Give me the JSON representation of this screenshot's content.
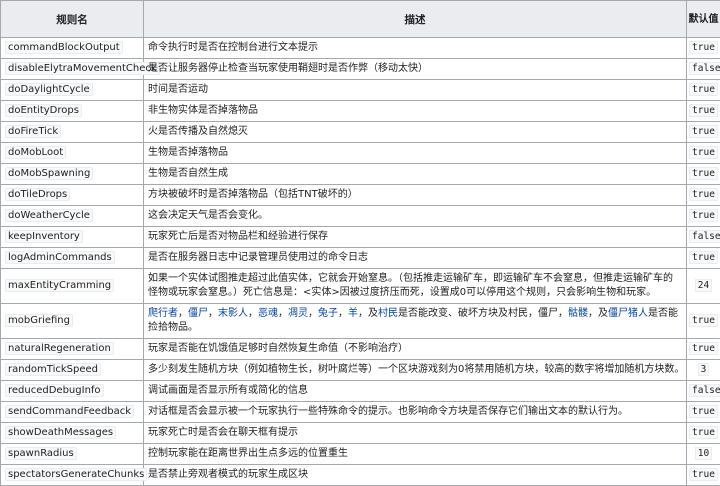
{
  "headers": {
    "rule": "规则名",
    "desc": "描述",
    "default": "默认值"
  },
  "rows": [
    {
      "name": "commandBlockOutput",
      "desc": "命令执行时是否在控制台进行文本提示",
      "default": "true"
    },
    {
      "name": "disableElytraMovementCheck",
      "desc": "是否让服务器停止检查当玩家使用鞘翅时是否作弊（移动太快）",
      "default": "false"
    },
    {
      "name": "doDaylightCycle",
      "desc": "时间是否运动",
      "default": "true"
    },
    {
      "name": "doEntityDrops",
      "desc": "非生物实体是否掉落物品",
      "default": "true"
    },
    {
      "name": "doFireTick",
      "desc": "火是否传播及自然熄灭",
      "default": "true"
    },
    {
      "name": "doMobLoot",
      "desc": "生物是否掉落物品",
      "default": "true"
    },
    {
      "name": "doMobSpawning",
      "desc": "生物是否自然生成",
      "default": "true"
    },
    {
      "name": "doTileDrops",
      "desc": "方块被破坏时是否掉落物品（包括TNT破坏的）",
      "default": "true"
    },
    {
      "name": "doWeatherCycle",
      "desc": "这会决定天气是否会变化。",
      "default": "true"
    },
    {
      "name": "keepInventory",
      "desc": "玩家死亡后是否对物品栏和经验进行保存",
      "default": "false"
    },
    {
      "name": "logAdminCommands",
      "desc": "是否在服务器日志中记录管理员使用过的命令日志",
      "default": "true"
    },
    {
      "name": "maxEntityCramming",
      "desc": "如果一个实体试图推走超过此值实体，它就会开始窒息。（包括推走运输矿车，即运输矿车不会窒息，但推走运输矿车的怪物或玩家会窒息。）死亡信息是：<实体>因被过度挤压而死，设置成0可以停用这个规则，只会影响生物和玩家。",
      "default": "24"
    },
    {
      "name": "mobGriefing",
      "default": "true",
      "mob": {
        "creeper": "爬行者",
        "sep1": "，",
        "ghast": "僵尸",
        "sep2": "，",
        "enderman": "末影人",
        "sep3": "，",
        "evoker": "恶魂",
        "sep4": "，",
        "wither": "凋灵",
        "sep5": "，",
        "rabbit": "兔子",
        "sep6": "，",
        "sheep": "羊",
        "sep7": "，及",
        "villager": "村民",
        "t1": "是否能改变、破坏方块及村民，僵尸，",
        "skeleton": "骷髅",
        "t2": "，及",
        "pigman": "僵尸猪人",
        "t3": "是否能捡拾物品。"
      }
    },
    {
      "name": "naturalRegeneration",
      "desc": "玩家是否能在饥饿值足够时自然恢复生命值（不影响治疗）",
      "default": "true"
    },
    {
      "name": "randomTickSpeed",
      "desc": "多少刻发生随机方块（例如植物生长，树叶腐烂等）一个区块游戏刻为0将禁用随机方块，较高的数字将增加随机方块数。",
      "default": "3"
    },
    {
      "name": "reducedDebugInfo",
      "desc": "调试画面是否显示所有或简化的信息",
      "default": "false"
    },
    {
      "name": "sendCommandFeedback",
      "desc": "对话框是否会显示被一个玩家执行一些特殊命令的提示。也影响命令方块是否保存它们输出文本的默认行为。",
      "default": "true"
    },
    {
      "name": "showDeathMessages",
      "desc": "玩家死亡时是否会在聊天框有提示",
      "default": "true"
    },
    {
      "name": "spawnRadius",
      "desc": "控制玩家能在距离世界出生点多远的位置重生",
      "default": "10"
    },
    {
      "name": "spectatorsGenerateChunks",
      "desc": "是否禁止旁观者模式的玩家生成区块",
      "default": "true"
    }
  ]
}
